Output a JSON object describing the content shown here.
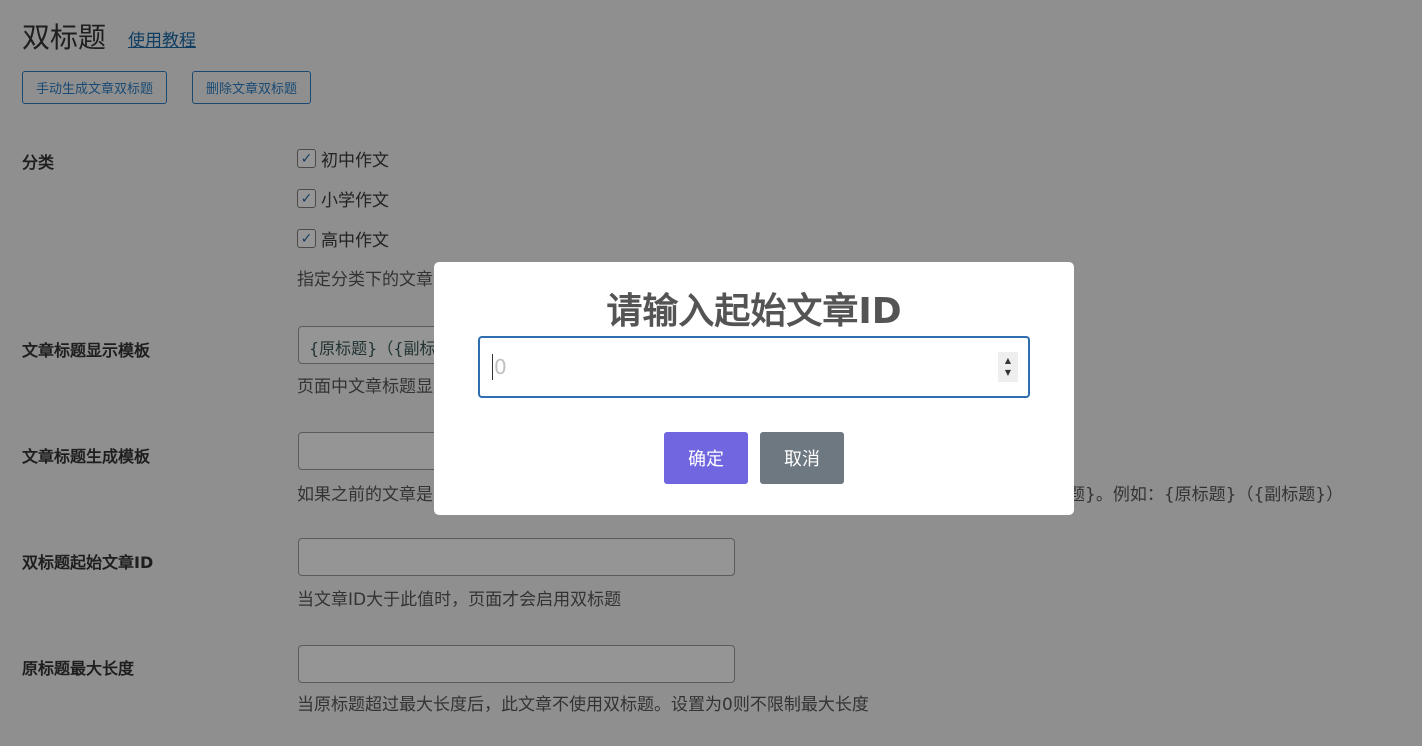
{
  "header": {
    "title": "双标题",
    "tutorial_link": "使用教程"
  },
  "toolbar": {
    "generate": "手动生成文章双标题",
    "delete": "删除文章双标题"
  },
  "fields": {
    "category": {
      "label": "分类",
      "options": [
        "初中作文",
        "小学作文",
        "高中作文"
      ],
      "desc": "指定分类下的文章"
    },
    "display_template": {
      "label": "文章标题显示模板",
      "value": "{原标题}（{副标题",
      "desc": "页面中文章标题显"
    },
    "gen_template": {
      "label": "文章标题生成模板",
      "value": "",
      "desc_left": "如果之前的文章是",
      "desc_right": "题}。例如：{原标题}（{副标题}）"
    },
    "start_id": {
      "label": "双标题起始文章ID",
      "value": "",
      "desc": "当文章ID大于此值时，页面才会启用双标题"
    },
    "max_len": {
      "label": "原标题最大长度",
      "value": "",
      "desc": "当原标题超过最大长度后，此文章不使用双标题。设置为0则不限制最大长度"
    }
  },
  "modal": {
    "title": "请输入起始文章ID",
    "placeholder": "0",
    "confirm": "确定",
    "cancel": "取消",
    "confirm_color": "#7066e0",
    "cancel_color": "#6e7881"
  }
}
